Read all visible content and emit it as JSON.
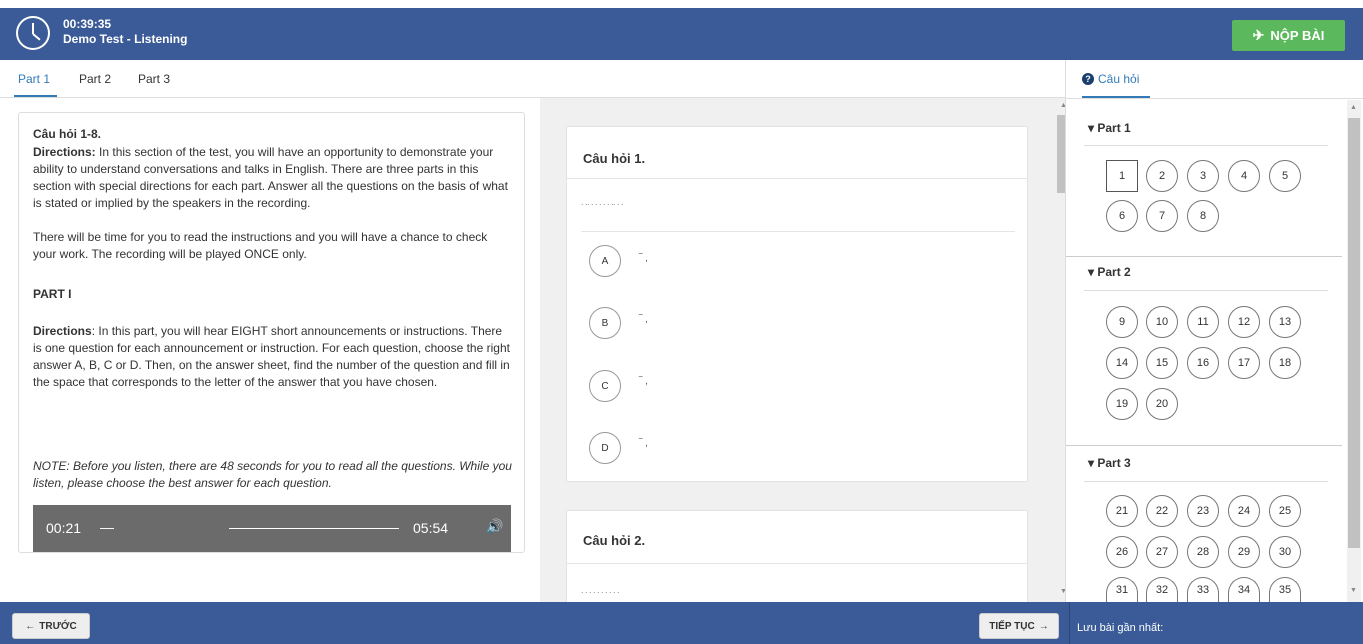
{
  "header": {
    "timer": "00:39:35",
    "test_name": "Demo Test - Listening",
    "submit_label": "NỘP BÀI"
  },
  "tabs": [
    "Part 1",
    "Part 2",
    "Part 3"
  ],
  "directions": {
    "title": "Câu hỏi 1-8.",
    "intro_label": "Directions:",
    "intro": "In this section of the test, you will have an opportunity to demonstrate your ability to understand conversations and talks in English. There are three parts in this section with special directions for each part. Answer all the questions on the basis of what is stated or implied by the speakers in the recording.",
    "intro2": "There will be time for you to read the instructions and you will have a chance to check your work. The recording will be played ONCE only.",
    "part_heading": "PART I",
    "part_label": "Directions",
    "part_text": ": In this part, you will hear EIGHT short announcements or instructions. There is one question for each announcement or instruction. For each question, choose the right answer A, B, C or D. Then, on the answer sheet, find the number of the question and fill in the space that corresponds to the letter of the answer that you have chosen.",
    "note": "NOTE: Before you listen, there are 48 seconds for you to read all the questions. While you listen, please choose the best answer for each question."
  },
  "audio": {
    "current": "00:21",
    "separator": "—",
    "duration": "05:54",
    "icon": "speaker-icon"
  },
  "questions": [
    {
      "title": "Câu hỏi 1.",
      "options": [
        "A",
        "B",
        "C",
        "D"
      ]
    },
    {
      "title": "Câu hỏi 2."
    }
  ],
  "right_panel": {
    "tab_label": "Câu hỏi",
    "parts": [
      {
        "name": "Part 1",
        "numbers": [
          "1",
          "2",
          "3",
          "4",
          "5",
          "6",
          "7",
          "8"
        ]
      },
      {
        "name": "Part 2",
        "numbers": [
          "9",
          "10",
          "11",
          "12",
          "13",
          "14",
          "15",
          "16",
          "17",
          "18",
          "19",
          "20"
        ]
      },
      {
        "name": "Part 3",
        "numbers": [
          "21",
          "22",
          "23",
          "24",
          "25",
          "26",
          "27",
          "28",
          "29",
          "30",
          "31",
          "32",
          "33",
          "34",
          "35"
        ]
      }
    ]
  },
  "footer": {
    "prev_label": "TRƯỚC",
    "next_label": "TIẾP TỤC",
    "last_save": "Lưu bài gần nhất:"
  },
  "colors": {
    "header": "#3a5b97",
    "submit": "#5cb85c",
    "accent": "#337ab7"
  }
}
